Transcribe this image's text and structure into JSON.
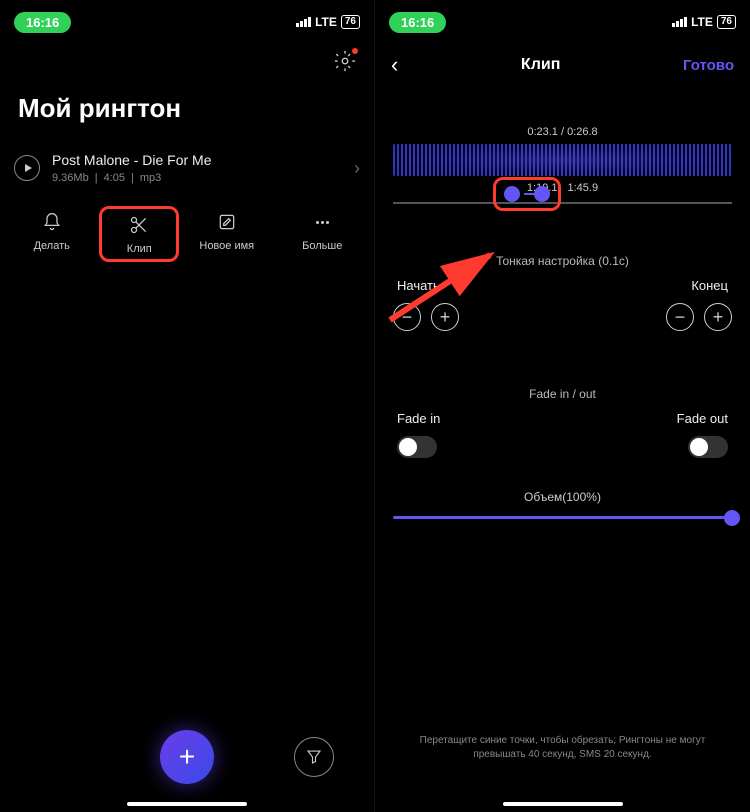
{
  "status": {
    "time": "16:16",
    "network": "LTE",
    "battery": "76"
  },
  "left": {
    "page_title": "Мой рингтон",
    "track": {
      "title": "Post Malone - Die For Me",
      "size": "9.36Mb",
      "duration": "4:05",
      "format": "mp3"
    },
    "actions": {
      "make": "Делать",
      "clip": "Клип",
      "rename": "Новое имя",
      "more": "Больше"
    }
  },
  "right": {
    "header": {
      "title": "Клип",
      "done": "Готово"
    },
    "time_pos": "0:23.1 / 0:26.8",
    "range_start": "1:19.1",
    "range_end": "1:45.9",
    "fine_tune": "Тонкая настройка (0.1c)",
    "start_label": "Начать",
    "end_label": "Конец",
    "fade_section": "Fade in / out",
    "fade_in": "Fade in",
    "fade_out": "Fade out",
    "volume_label": "Объем(100%)",
    "hint": "Перетащите синие точки, чтобы обрезать; Рингтоны не могут превышать 40 секунд, SMS 20 секунд."
  }
}
